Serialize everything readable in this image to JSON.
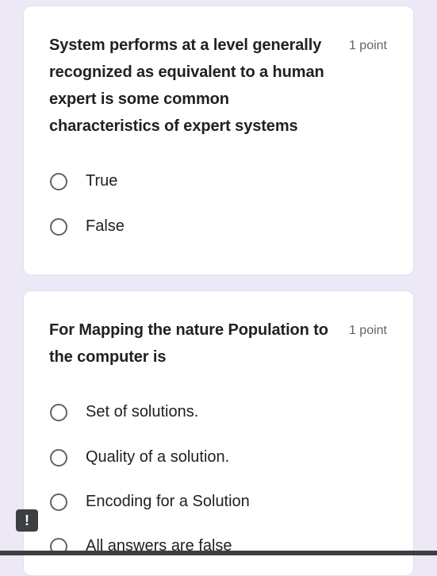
{
  "questions": [
    {
      "text": "System performs at a level generally recognized as equivalent to a human expert is some common characteristics of expert systems",
      "points": "1 point",
      "options": [
        "True",
        "False"
      ]
    },
    {
      "text": "For Mapping the nature Population to the computer is",
      "points": "1 point",
      "options": [
        "Set of solutions.",
        "Quality of a solution.",
        "Encoding for a Solution",
        "All answers are false"
      ]
    }
  ],
  "report_icon": "!",
  "icons": {
    "report": "report-exclamation-icon",
    "radio": "radio-unchecked-icon"
  },
  "colors": {
    "page_background": "#ece8f5",
    "card_background": "#ffffff",
    "text": "#202124",
    "secondary_text": "#5f6368"
  }
}
